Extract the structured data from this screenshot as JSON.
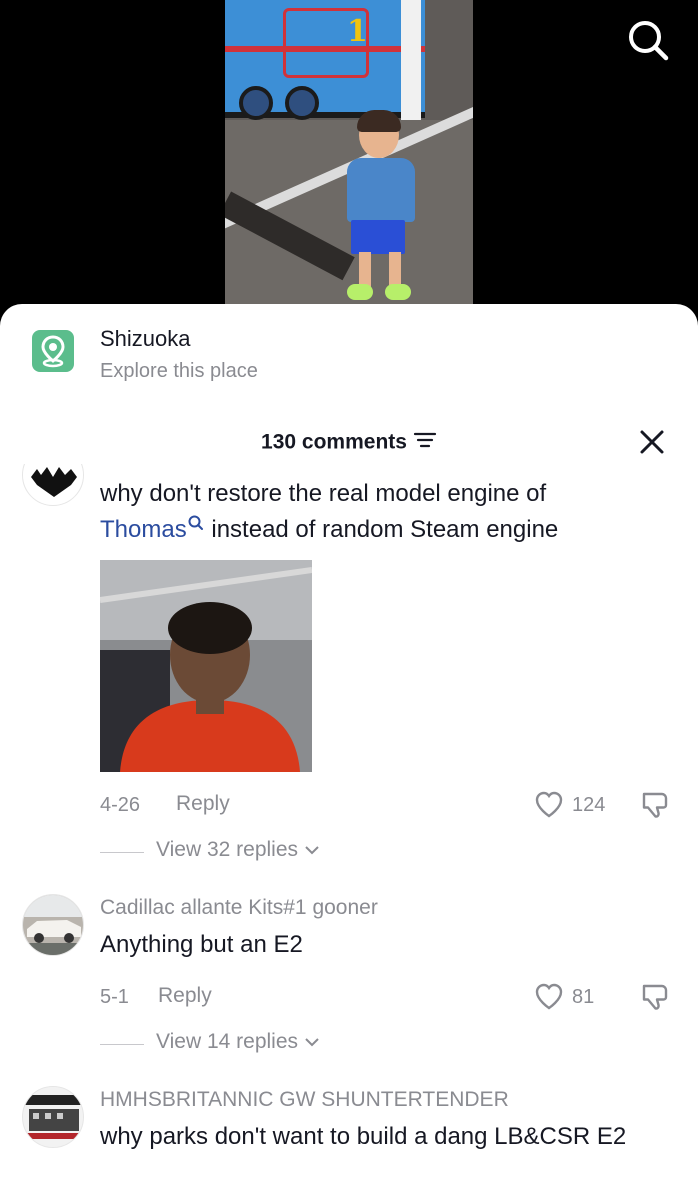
{
  "location": {
    "name": "Shizuoka",
    "subtitle": "Explore this place"
  },
  "video": {
    "train_number": "1"
  },
  "comments_header": {
    "title": "130 comments"
  },
  "comments": [
    {
      "username": "",
      "text_before": "why don't restore the real model engine of",
      "highlight": "Thomas",
      "text_after": "instead of random Steam engine",
      "date": "4-26",
      "reply_label": "Reply",
      "likes": "124",
      "view_replies": "View 32 replies"
    },
    {
      "username": "Cadillac allante Kits#1 gooner",
      "text": "Anything but an E2",
      "date": "5-1",
      "reply_label": "Reply",
      "likes": "81",
      "view_replies": "View 14 replies"
    },
    {
      "username": "HMHSBRITANNIC GW SHUNTERTENDER",
      "text": "why parks don't want to build a dang LB&CSR E2"
    }
  ],
  "colors": {
    "accent_link": "#2b4c9f",
    "place_icon": "#5bbd8c",
    "muted_text": "#8a8b91"
  },
  "icons": [
    "search-icon",
    "location-pin-icon",
    "sort-icon",
    "close-icon",
    "heart-icon",
    "dislike-icon",
    "chevron-down-icon"
  ]
}
